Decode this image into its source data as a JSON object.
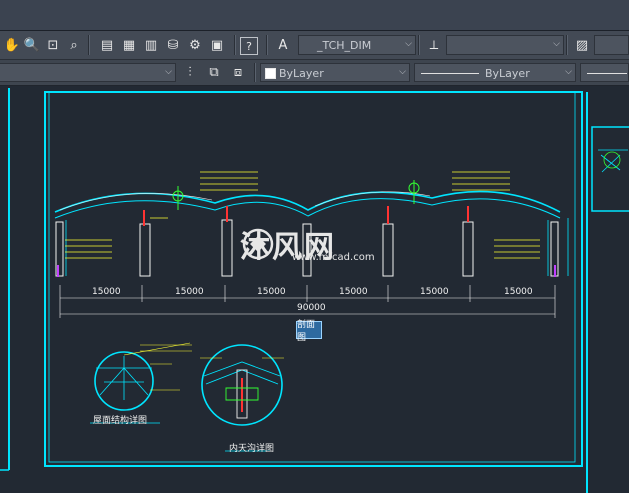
{
  "toolbar": {
    "dimstyle_value": "_TCH_DIM",
    "layer_color_value": "ByLayer",
    "linetype_value": "ByLayer"
  },
  "drawing": {
    "title_tag": "剖面图",
    "dimensions": [
      "15000",
      "15000",
      "15000",
      "15000",
      "15000",
      "15000"
    ],
    "total_dimension": "90000",
    "detail1_label": "屋面结构详图",
    "detail2_label": "内天沟详图",
    "watermark": "沐风网",
    "watermark_url": "www.mfcad.com",
    "colors": {
      "background": "#222933",
      "cyan": "#00e5ff",
      "yellow": "#ffff33",
      "green": "#33ff33",
      "red": "#ff3333",
      "white": "#f2f2f2"
    }
  }
}
